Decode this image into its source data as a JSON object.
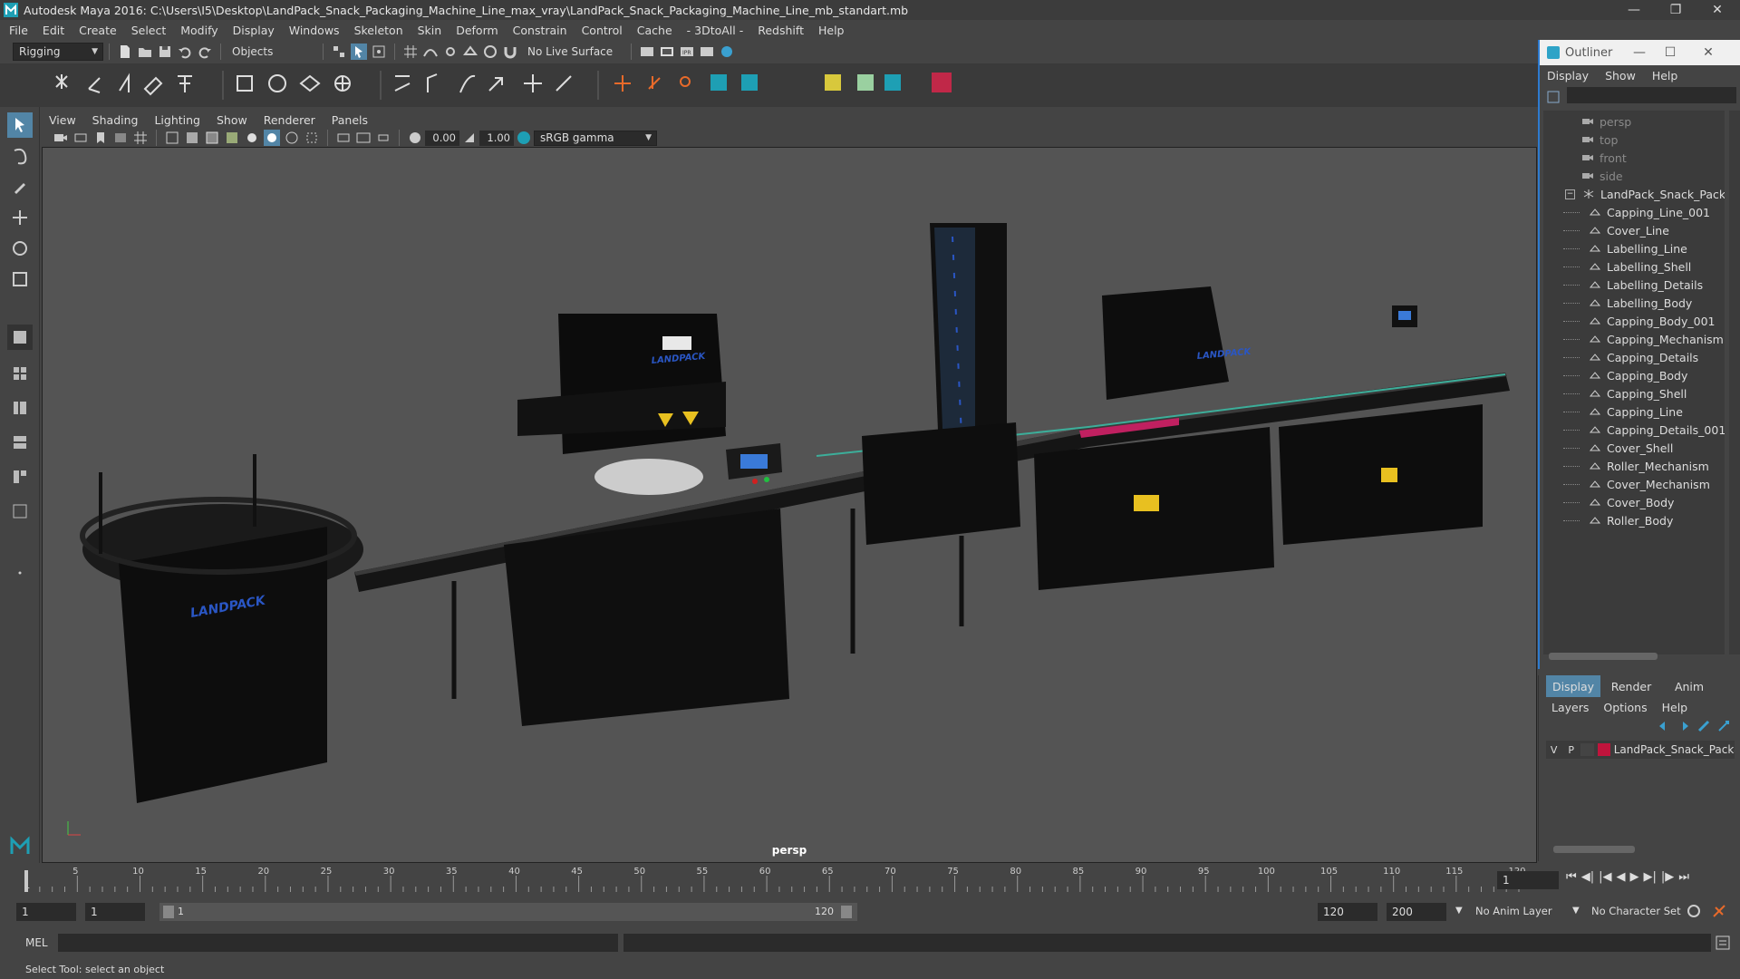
{
  "window": {
    "title": "Autodesk Maya 2016: C:\\Users\\I5\\Desktop\\LandPack_Snack_Packaging_Machine_Line_max_vray\\LandPack_Snack_Packaging_Machine_Line_mb_standart.mb"
  },
  "menubar": [
    "File",
    "Edit",
    "Create",
    "Select",
    "Modify",
    "Display",
    "Windows",
    "Skeleton",
    "Skin",
    "Deform",
    "Constrain",
    "Control",
    "Cache",
    "- 3DtoAll -",
    "Redshift",
    "Help"
  ],
  "statusline": {
    "menuset": "Rigging",
    "selection_mode": "Objects",
    "live_surface": "No Live Surface"
  },
  "panel": {
    "menus": [
      "View",
      "Shading",
      "Lighting",
      "Show",
      "Renderer",
      "Panels"
    ],
    "near_value": "0.00",
    "far_value": "1.00",
    "color_space": "sRGB gamma",
    "camera_label": "persp"
  },
  "viewport": {
    "brand_label": "LANDPACK"
  },
  "outliner": {
    "title": "Outliner",
    "menus": [
      "Display",
      "Show",
      "Help"
    ],
    "cameras": [
      "persp",
      "top",
      "front",
      "side"
    ],
    "group": "LandPack_Snack_Packaging_",
    "children": [
      "Capping_Line_001",
      "Cover_Line",
      "Labelling_Line",
      "Labelling_Shell",
      "Labelling_Details",
      "Labelling_Body",
      "Capping_Body_001",
      "Capping_Mechanism",
      "Capping_Details",
      "Capping_Body",
      "Capping_Shell",
      "Capping_Line",
      "Capping_Details_001",
      "Cover_Shell",
      "Roller_Mechanism",
      "Cover_Mechanism",
      "Cover_Body",
      "Roller_Body"
    ]
  },
  "channelbox": {
    "tabs": [
      "Display",
      "Render",
      "Anim"
    ],
    "menus": [
      "Layers",
      "Options",
      "Help"
    ],
    "layer": {
      "v": "V",
      "p": "P",
      "name": "LandPack_Snack_Packa",
      "color": "#c0143c"
    }
  },
  "timeline": {
    "ticks": [
      "5",
      "10",
      "15",
      "20",
      "25",
      "30",
      "35",
      "40",
      "45",
      "50",
      "55",
      "60",
      "65",
      "70",
      "75",
      "80",
      "85",
      "90",
      "95",
      "100",
      "105",
      "110",
      "115",
      "120"
    ],
    "current_frame": "1",
    "current_field": "1"
  },
  "range": {
    "start": "1",
    "start2": "1",
    "slider_start": "1",
    "slider_end": "120",
    "end": "120",
    "anim_end": "200",
    "anim_layer": "No Anim Layer",
    "char_set": "No Character Set"
  },
  "cmdline": {
    "label": "MEL"
  },
  "helpline": {
    "text": "Select Tool: select an object"
  },
  "colors": {
    "accent": "#2d7bd0",
    "viewport_bg": "#545454",
    "highlight": "#5285a6"
  }
}
